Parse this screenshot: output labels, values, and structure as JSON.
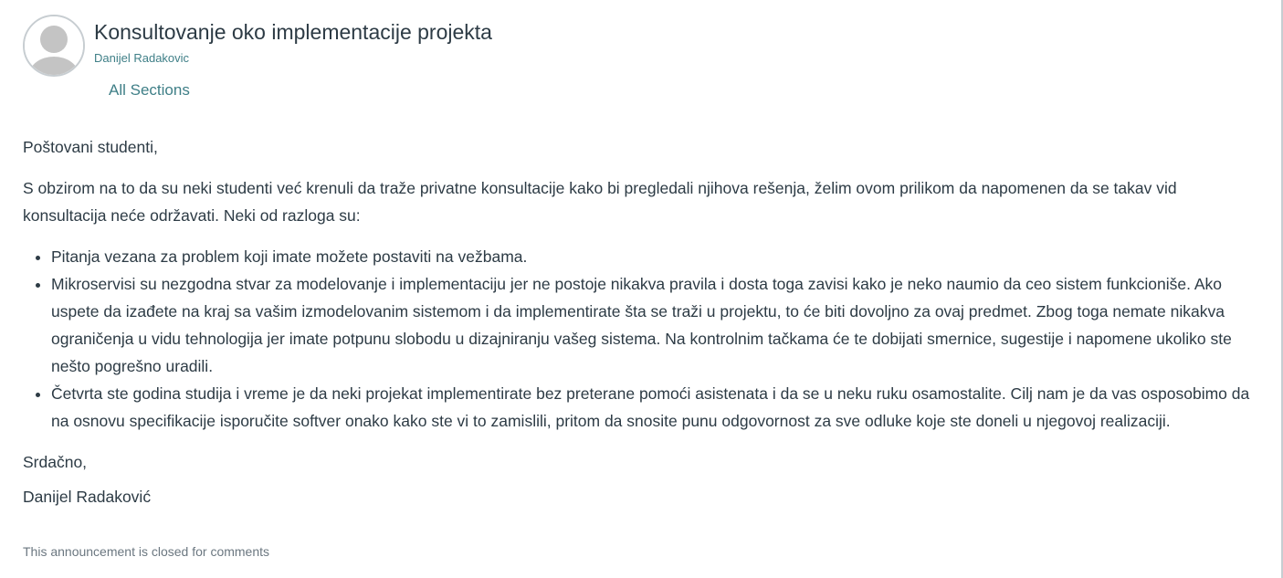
{
  "announcement": {
    "title": "Konsultovanje oko implementacije projekta",
    "author": "Danijel Radakovic",
    "sections": "All Sections"
  },
  "message": {
    "greeting": "Poštovani studenti,",
    "intro": "S obzirom na to da su neki studenti već krenuli da traže privatne konsultacije kako bi pregledali njihova rešenja, želim ovom prilikom da napomenen da se takav vid konsultacija neće održavati. Neki od razloga su:",
    "reasons": [
      "Pitanja vezana za problem koji imate možete postaviti na vežbama.",
      "Mikroservisi su nezgodna stvar za modelovanje i implementaciju jer ne postoje nikakva pravila i dosta toga zavisi kako je neko naumio da ceo sistem funkcioniše. Ako uspete da izađete na kraj sa vašim izmodelovanim sistemom i da implementirate šta se traži u projektu, to će biti dovoljno za ovaj predmet. Zbog toga nemate nikakva ograničenja u vidu tehnologija jer imate potpunu slobodu u dizajniranju vašeg sistema. Na kontrolnim tačkama će te dobijati smernice, sugestije i napomene ukoliko ste nešto pogrešno uradili.",
      "Četvrta ste godina studija i vreme je da neki projekat implementirate bez preterane pomoći asistenata i da se u neku ruku osamostalite. Cilj nam je da vas osposobimo da na osnovu specifikacije isporučite softver onako kako ste vi to zamislili, pritom da snosite  punu odgovornost za sve odluke koje ste doneli u njegovoj realizaciji."
    ],
    "closing": "Srdačno,",
    "signature": "Danijel Radaković"
  },
  "footer": {
    "comments_status": "This announcement is closed for comments"
  },
  "icons": {
    "avatar": "default-user-avatar-icon",
    "bullet": "bullet-icon"
  },
  "colors": {
    "text": "#2d3b45",
    "link": "#3f7f87",
    "muted": "#6b7780",
    "avatar_border": "#c7cdd1",
    "avatar_silhouette": "#c4c4c4"
  }
}
